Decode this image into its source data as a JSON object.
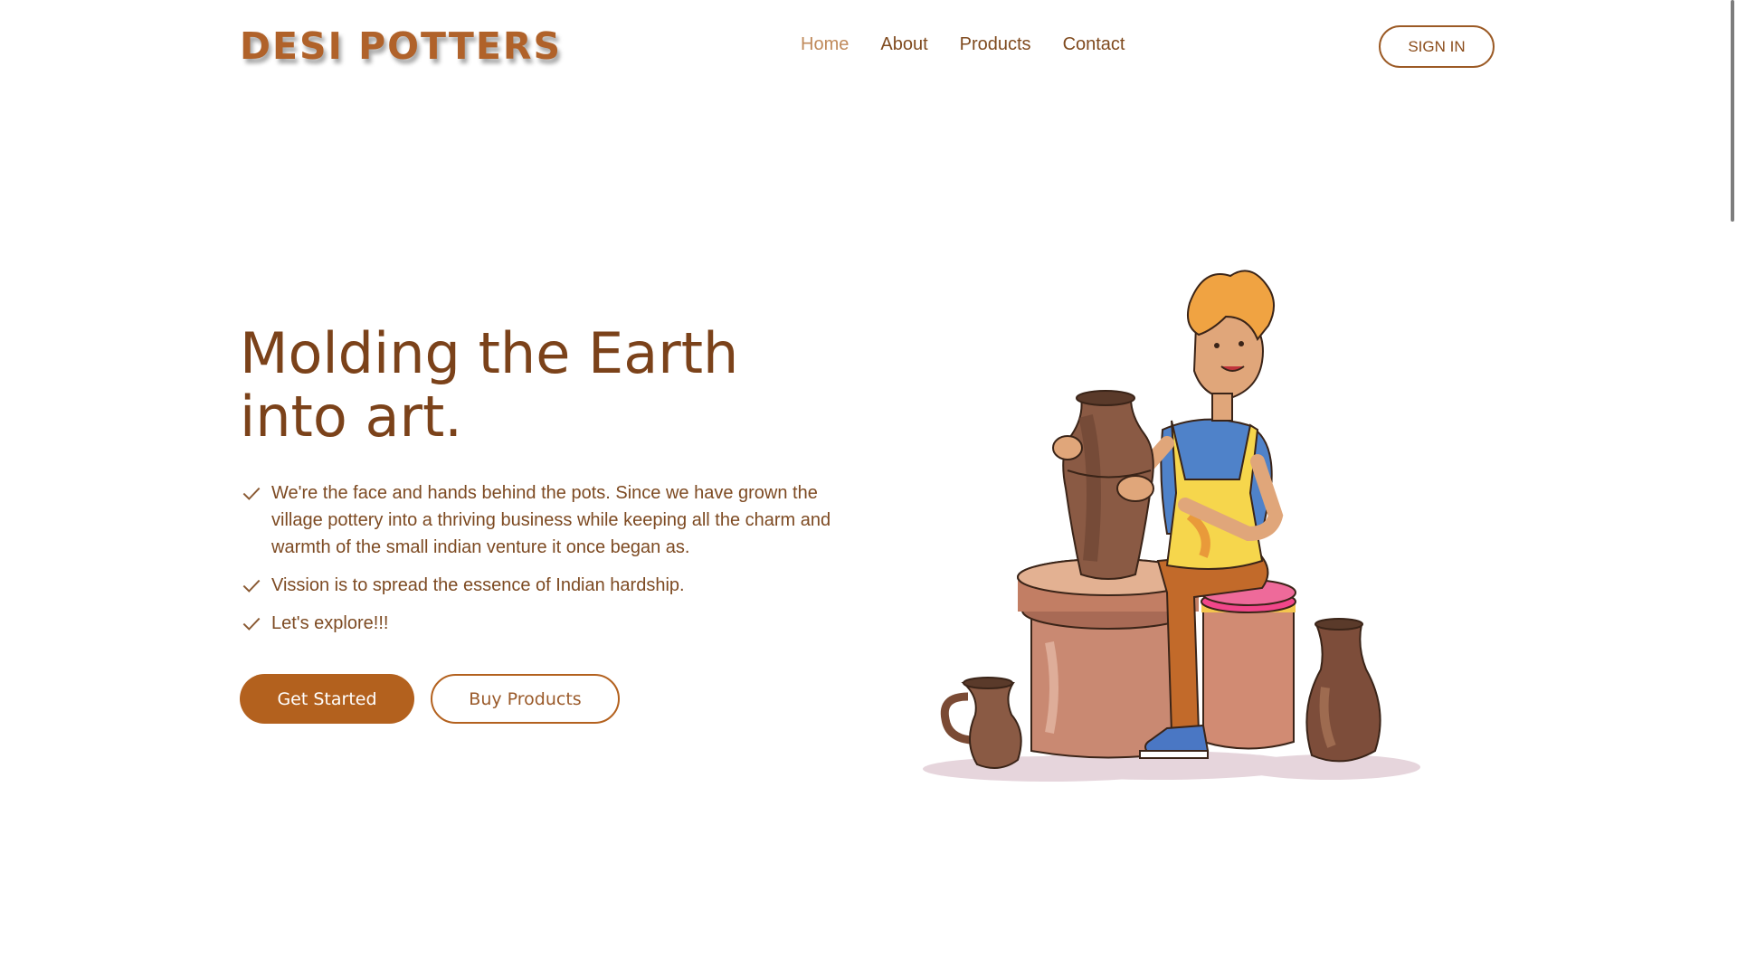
{
  "brand": {
    "logo_text": "DESI POTTERS"
  },
  "nav": {
    "items": [
      {
        "label": "Home",
        "active": true
      },
      {
        "label": "About",
        "active": false
      },
      {
        "label": "Products",
        "active": false
      },
      {
        "label": "Contact",
        "active": false
      }
    ],
    "signin_label": "SIGN IN"
  },
  "hero": {
    "title": "Molding the Earth into art.",
    "features": [
      "We're the face and hands behind the pots. Since we have grown the village pottery into a thriving business while keeping all the charm and warmth of the small indian venture it once began as.",
      "Vission is to spread the essence of Indian hardship.",
      "Let's explore!!!"
    ],
    "primary_button": "Get Started",
    "secondary_button": "Buy Products"
  },
  "colors": {
    "brand": "#b0622a",
    "primary_button": "#b3611e",
    "heading": "#7b421a",
    "nav_active": "#c08a5b"
  },
  "illustration": {
    "icon": "potter-at-wheel-illustration"
  }
}
